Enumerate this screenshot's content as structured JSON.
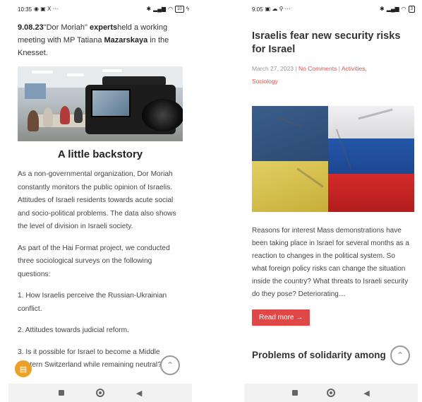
{
  "left_phone": {
    "status": {
      "time": "10:35",
      "icons_left": "◉ ▣ X ···",
      "battery": "10"
    },
    "lead": {
      "date": "9.08.23",
      "q1": "\"Dor Moriah\" ",
      "experts": "experts",
      "rest1": "held a working meeting with MP Tatiana ",
      "mp": "Mazarskaya",
      "rest2": " in the Knesset."
    },
    "heading": "A little backstory",
    "paragraphs": [
      "As a non-governmental organization, Dor Moriah constantly monitors the public opinion of Israelis. Attitudes of Israeli residents towards acute social and socio-political problems. The data also shows the level of division in Israeli society.",
      "As part of the Hai Format project, we conducted three sociological surveys on the following questions:",
      "1. How Israelis perceive the Russian-Ukrainian conflict.",
      "2. Attitudes towards judicial reform.",
      "3. Is it possible for Israel to become a Middle Eastern Switzerland while remaining neutral?"
    ]
  },
  "right_phone": {
    "status": {
      "time": "9:05",
      "icons_left": "▣ ☁ ⚲ ···",
      "battery": "3"
    },
    "title": "Israelis fear new security risks for Israel",
    "meta": {
      "date": "March 27, 2023",
      "sep": " | ",
      "comments": "No Comments",
      "sep2": " | ",
      "cat1": "Activities",
      "comma": ",",
      "cat2": "Sociology"
    },
    "body": "Reasons for interest Mass demonstrations have been taking place in Israel for several months as a reaction to changes in the political system. So what foreign policy risks can change the situation inside the country? What threats to Israeli security do they pose? Deteriorating…",
    "read_more": "Read more →",
    "next_title": "Problems of solidarity among"
  },
  "icons": {
    "chat": "chat-bubble-icon",
    "up": "⌃",
    "back": "◀"
  }
}
